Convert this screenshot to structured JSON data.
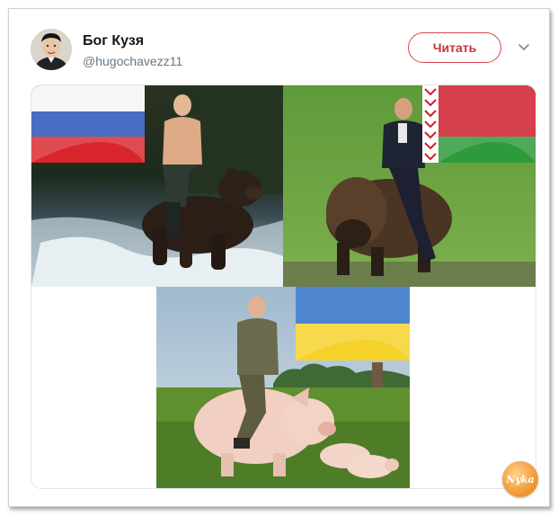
{
  "tweet": {
    "display_name": "Бог Кузя",
    "handle": "@hugochavezz11",
    "follow_label": "Читать"
  },
  "media": {
    "panels": [
      {
        "flag": "russia-flag",
        "scene": "rider-on-bear"
      },
      {
        "flag": "belarus-flag",
        "scene": "rider-on-bison"
      },
      {
        "flag": "ukraine-flag",
        "scene": "rider-on-pig"
      }
    ]
  },
  "watermark": {
    "text": "Nyka"
  },
  "colors": {
    "follow_accent": "#c8323a",
    "handle_gray": "#657786"
  }
}
